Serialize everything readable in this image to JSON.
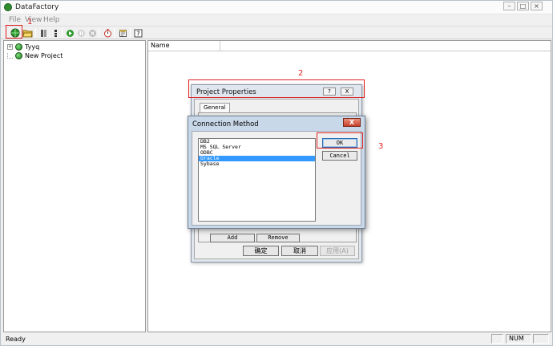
{
  "window": {
    "title": "DataFactory"
  },
  "menu": [
    "File",
    "View",
    "Help"
  ],
  "tree": {
    "items": [
      "Tyyq",
      "New Project"
    ]
  },
  "list": {
    "column_name": "Name"
  },
  "status": {
    "text": "Ready",
    "num": "NUM"
  },
  "project_properties": {
    "title": "Project Properties",
    "help_glyph": "?",
    "close_glyph": "X",
    "tab": "General",
    "add_label": "Add",
    "remove_label": "Remove",
    "ok_label": "确定",
    "cancel_label": "取消",
    "apply_label": "应用(A)"
  },
  "connection_method": {
    "title": "Connection Method",
    "close_glyph": "X",
    "options": [
      "DB2",
      "MS SQL Server",
      "ODBC",
      "Oracle",
      "Sybase"
    ],
    "selected_option": "Oracle",
    "ok_label": "OK",
    "cancel_label": "Cancel"
  },
  "annotations": [
    "1",
    "2",
    "3"
  ],
  "colors": {
    "annotation": "#e02020",
    "selection": "#3399ff",
    "globe": "#2f8c2f"
  }
}
